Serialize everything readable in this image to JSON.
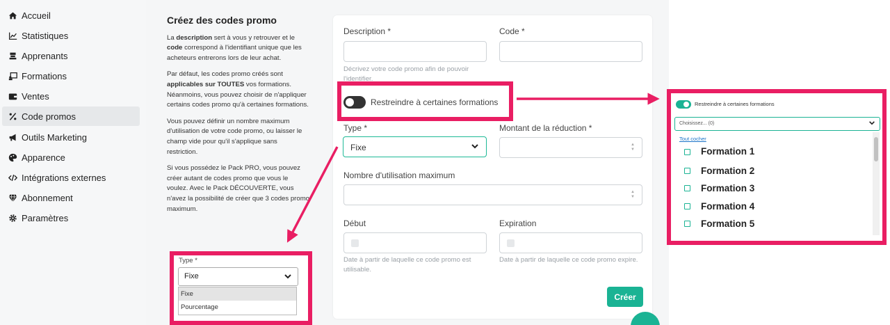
{
  "sidebar": {
    "items": [
      {
        "label": "Accueil",
        "icon": "home-icon"
      },
      {
        "label": "Statistiques",
        "icon": "chart-line-icon"
      },
      {
        "label": "Apprenants",
        "icon": "learners-icon"
      },
      {
        "label": "Formations",
        "icon": "chalkboard-icon"
      },
      {
        "label": "Ventes",
        "icon": "wallet-icon"
      },
      {
        "label": "Code promos",
        "icon": "percent-icon"
      },
      {
        "label": "Outils Marketing",
        "icon": "bullhorn-icon"
      },
      {
        "label": "Apparence",
        "icon": "palette-icon"
      },
      {
        "label": "Intégrations externes",
        "icon": "code-icon"
      },
      {
        "label": "Abonnement",
        "icon": "gem-icon"
      },
      {
        "label": "Paramètres",
        "icon": "gear-icon"
      }
    ],
    "active_index": 5
  },
  "info": {
    "title": "Créez des codes promo",
    "p1": {
      "a": "La ",
      "b1": "description",
      "c": " sert à vous y retrouver et le ",
      "b2": "code",
      "d": " correspond à l'identifiant unique que les acheteurs entrerons lors de leur achat."
    },
    "p2": {
      "a": "Par défaut, les codes promo créés sont ",
      "b1": "applicables sur TOUTES",
      "c": " vos formations. Néanmoins, vous pouvez choisir de n'appliquer certains codes promo qu'à certaines formations."
    },
    "p3": "Vous pouvez définir un nombre maximum d'utilisation de votre code promo, ou laisser le champ vide pour qu'il s'applique sans restriction.",
    "p4": "Si vous possédez le Pack PRO, vous pouvez créer autant de codes promo que vous le voulez. Avec le Pack DÉCOUVERTE, vous n'avez la possibilité de créer que 3 codes promo maximum."
  },
  "form": {
    "description_label": "Description *",
    "code_label": "Code *",
    "description_help": "Décrivez votre code promo afin de pouvoir l'identifier.",
    "restrict_label": "Restreindre à certaines formations",
    "restrict_on": false,
    "type_label": "Type *",
    "type_value": "Fixe",
    "amount_label": "Montant de la réduction *",
    "max_use_label": "Nombre d'utilisation maximum",
    "start_label": "Début",
    "start_help": "Date à partir de laquelle ce code promo est utilisable.",
    "expiration_label": "Expiration",
    "expiration_help": "Date à partir de laquelle ce code promo expire.",
    "create_button": "Créer"
  },
  "dropdown_callout": {
    "label": "Type *",
    "value": "Fixe",
    "options": [
      "Fixe",
      "Pourcentage"
    ],
    "selected_index": 0
  },
  "restrict_callout": {
    "toggle_label": "Restreindre à certaines formations",
    "toggle_on": true,
    "select_placeholder": "Choisissez... (0)",
    "check_all": "Tout cocher",
    "formations": [
      "Formation 1",
      "Formation 2",
      "Formation 3",
      "Formation 4",
      "Formation 5"
    ]
  },
  "colors": {
    "accent": "#1ab394",
    "highlight": "#e91e63",
    "sidebar_bg": "#f6f7f8"
  }
}
